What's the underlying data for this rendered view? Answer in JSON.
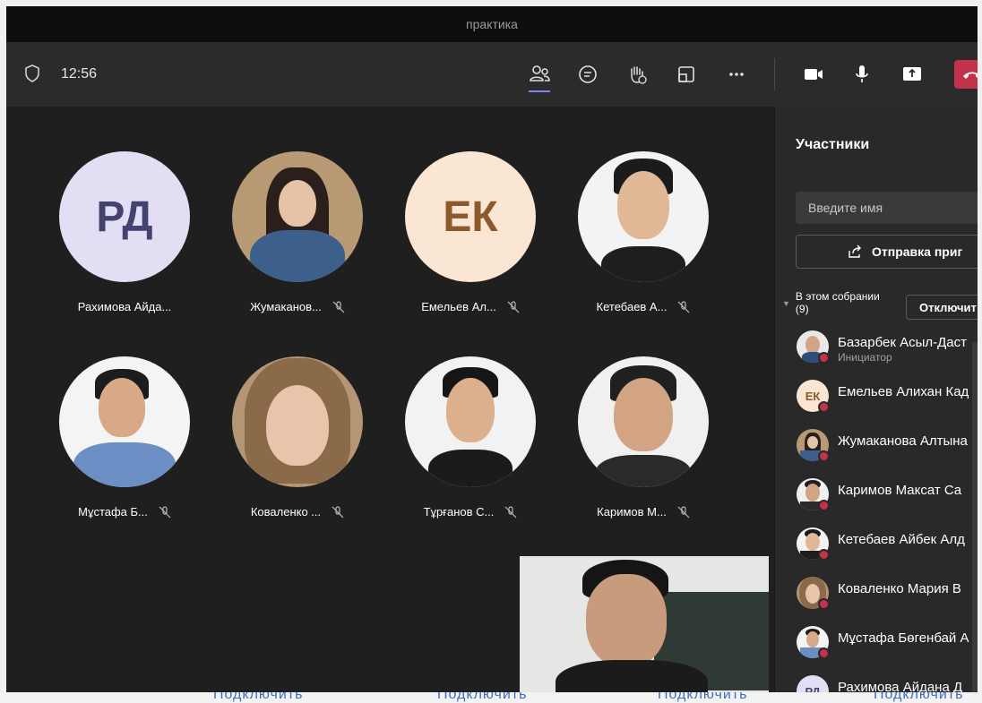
{
  "window": {
    "title": "практика"
  },
  "toolbar": {
    "time": "12:56",
    "icons": [
      "people-icon",
      "chat-icon",
      "raise-hand-icon",
      "rooms-icon",
      "more-icon",
      "camera-icon",
      "mic-icon",
      "share-icon",
      "hangup-icon"
    ]
  },
  "stage": {
    "tiles": [
      {
        "name": "Рахимова Айда...",
        "initials": "РД",
        "muted": false
      },
      {
        "name": "Жумаканов...",
        "muted": true
      },
      {
        "name": "Емельев Ал...",
        "initials": "ЕК",
        "muted": true
      },
      {
        "name": "Кетебаев А...",
        "muted": true
      },
      {
        "name": "Мұстафа Б...",
        "muted": true
      },
      {
        "name": "Коваленко ...",
        "muted": true
      },
      {
        "name": "Тұрғанов С...",
        "muted": true
      },
      {
        "name": "Каримов М...",
        "muted": true
      }
    ]
  },
  "panel": {
    "title": "Участники",
    "search_placeholder": "Введите имя",
    "invite_label": "Отправка приг",
    "section_line1": "В этом собрании",
    "section_line2": "(9)",
    "mute_all_label": "Отключит",
    "participants": [
      {
        "name": "Базарбек Асыл-Даст",
        "role": "Инициатор"
      },
      {
        "name": "Емельев Алихан Кад",
        "initials": "ЕК"
      },
      {
        "name": "Жумаканова Алтына"
      },
      {
        "name": "Каримов Максат Сa"
      },
      {
        "name": "Кетебаев Айбек Алд"
      },
      {
        "name": "Коваленко Мария В"
      },
      {
        "name": "Мұстафа Бөгенбай А"
      },
      {
        "name": "Рахимова Айдана Д",
        "initials": "РД"
      }
    ]
  },
  "bottom": {
    "labels": [
      "Подключить",
      "Подключить",
      "Подключить",
      "Подключить"
    ]
  },
  "colors": {
    "accent": "#7f85f5",
    "hangup": "#c4314b",
    "avatar_rd_bg": "#e3def3",
    "avatar_ek_bg": "#fbe6d4"
  }
}
